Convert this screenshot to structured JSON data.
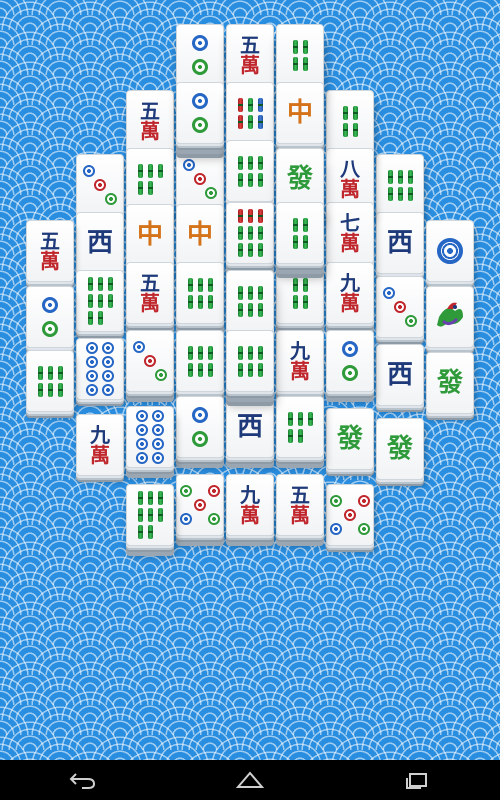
{
  "theme": {
    "background": "#2a8ee0",
    "tile_face": "#ffffff",
    "bamboo_green": "#2e9a3a",
    "character_red": "#c0272d",
    "navy": "#1f3a7a"
  },
  "tiles": [
    {
      "id": "t1",
      "kind": "circles",
      "count": 2,
      "label": ""
    },
    {
      "id": "t2",
      "kind": "character",
      "top": "五",
      "bottom": "萬"
    },
    {
      "id": "t3",
      "kind": "bamboo",
      "count": 4,
      "label": ""
    },
    {
      "id": "t4",
      "kind": "character",
      "top": "五",
      "bottom": "萬"
    },
    {
      "id": "t5",
      "kind": "circles",
      "count": 2,
      "label": ""
    },
    {
      "id": "t6",
      "kind": "bamboo",
      "count": 6,
      "label": ""
    },
    {
      "id": "t7",
      "kind": "honor",
      "text": "中"
    },
    {
      "id": "t8",
      "kind": "bamboo",
      "count": 4,
      "label": ""
    },
    {
      "id": "t9",
      "kind": "circles",
      "count": 3,
      "label": ""
    },
    {
      "id": "t10",
      "kind": "bamboo",
      "count": 5,
      "label": ""
    },
    {
      "id": "t11",
      "kind": "circles",
      "count": 3,
      "label": ""
    },
    {
      "id": "t12",
      "kind": "bamboo",
      "count": 6,
      "label": ""
    },
    {
      "id": "t13",
      "kind": "honor",
      "text": "發"
    },
    {
      "id": "t14",
      "kind": "character",
      "top": "八",
      "bottom": "萬"
    },
    {
      "id": "t15",
      "kind": "bamboo",
      "count": 6,
      "label": ""
    },
    {
      "id": "t16",
      "kind": "honor",
      "text": "西"
    },
    {
      "id": "t17",
      "kind": "honor",
      "text": "中"
    },
    {
      "id": "t18",
      "kind": "honor",
      "text": "中"
    },
    {
      "id": "t19",
      "kind": "bamboo",
      "count": 9,
      "label": ""
    },
    {
      "id": "t20",
      "kind": "bamboo",
      "count": 4,
      "label": ""
    },
    {
      "id": "t21",
      "kind": "character",
      "top": "七",
      "bottom": "萬"
    },
    {
      "id": "t22",
      "kind": "honor",
      "text": "西"
    },
    {
      "id": "t23",
      "kind": "circles",
      "count": 1,
      "label": ""
    },
    {
      "id": "t24",
      "kind": "character",
      "top": "五",
      "bottom": "萬"
    },
    {
      "id": "t25",
      "kind": "character",
      "top": "五",
      "bottom": "萬"
    },
    {
      "id": "t26",
      "kind": "bamboo",
      "count": 6,
      "label": ""
    },
    {
      "id": "t27",
      "kind": "bamboo",
      "count": 6,
      "label": ""
    },
    {
      "id": "t28",
      "kind": "bamboo",
      "count": 4,
      "label": ""
    },
    {
      "id": "t29",
      "kind": "character",
      "top": "九",
      "bottom": "萬"
    },
    {
      "id": "t30",
      "kind": "bamboo",
      "count": 8,
      "label": ""
    },
    {
      "id": "t31",
      "kind": "circles",
      "count": 3,
      "label": ""
    },
    {
      "id": "t32",
      "kind": "bird",
      "label": ""
    },
    {
      "id": "t33",
      "kind": "circles",
      "count": 2,
      "label": ""
    },
    {
      "id": "t34",
      "kind": "bamboo",
      "count": 6,
      "label": ""
    },
    {
      "id": "t35",
      "kind": "circles",
      "count": 8,
      "label": ""
    },
    {
      "id": "t36",
      "kind": "circles",
      "count": 3,
      "label": ""
    },
    {
      "id": "t37",
      "kind": "bamboo",
      "count": 6,
      "label": ""
    },
    {
      "id": "t38",
      "kind": "bamboo",
      "count": 6,
      "label": ""
    },
    {
      "id": "t39",
      "kind": "character",
      "top": "九",
      "bottom": "萬"
    },
    {
      "id": "t40",
      "kind": "circles",
      "count": 2,
      "label": ""
    },
    {
      "id": "t41",
      "kind": "honor",
      "text": "西"
    },
    {
      "id": "t42",
      "kind": "honor",
      "text": "發"
    },
    {
      "id": "t43",
      "kind": "character",
      "top": "九",
      "bottom": "萬"
    },
    {
      "id": "t44",
      "kind": "circles",
      "count": 8,
      "label": ""
    },
    {
      "id": "t45",
      "kind": "circles",
      "count": 2,
      "label": ""
    },
    {
      "id": "t46",
      "kind": "honor",
      "text": "西"
    },
    {
      "id": "t47",
      "kind": "bamboo",
      "count": 5,
      "label": ""
    },
    {
      "id": "t48",
      "kind": "honor",
      "text": "發"
    },
    {
      "id": "t49",
      "kind": "honor",
      "text": "發"
    },
    {
      "id": "t50",
      "kind": "bamboo",
      "count": 8,
      "label": ""
    },
    {
      "id": "t51",
      "kind": "circles",
      "count": 5,
      "label": ""
    },
    {
      "id": "t52",
      "kind": "character",
      "top": "九",
      "bottom": "萬"
    },
    {
      "id": "t53",
      "kind": "character",
      "top": "五",
      "bottom": "萬"
    },
    {
      "id": "t54",
      "kind": "circles",
      "count": 5,
      "label": ""
    }
  ],
  "navbar": {
    "back_icon": "back-arrow-icon",
    "home_icon": "home-icon",
    "recents_icon": "recents-icon"
  }
}
